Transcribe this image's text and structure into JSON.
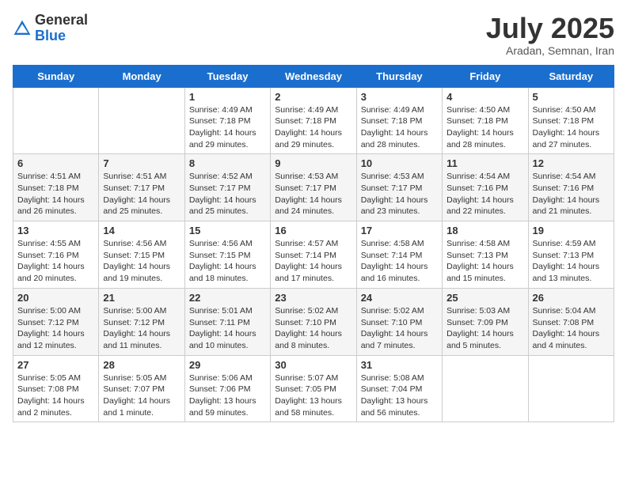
{
  "header": {
    "logo_general": "General",
    "logo_blue": "Blue",
    "month_title": "July 2025",
    "subtitle": "Aradan, Semnan, Iran"
  },
  "days_of_week": [
    "Sunday",
    "Monday",
    "Tuesday",
    "Wednesday",
    "Thursday",
    "Friday",
    "Saturday"
  ],
  "weeks": [
    [
      {
        "day": "",
        "detail": ""
      },
      {
        "day": "",
        "detail": ""
      },
      {
        "day": "1",
        "detail": "Sunrise: 4:49 AM\nSunset: 7:18 PM\nDaylight: 14 hours and 29 minutes."
      },
      {
        "day": "2",
        "detail": "Sunrise: 4:49 AM\nSunset: 7:18 PM\nDaylight: 14 hours and 29 minutes."
      },
      {
        "day": "3",
        "detail": "Sunrise: 4:49 AM\nSunset: 7:18 PM\nDaylight: 14 hours and 28 minutes."
      },
      {
        "day": "4",
        "detail": "Sunrise: 4:50 AM\nSunset: 7:18 PM\nDaylight: 14 hours and 28 minutes."
      },
      {
        "day": "5",
        "detail": "Sunrise: 4:50 AM\nSunset: 7:18 PM\nDaylight: 14 hours and 27 minutes."
      }
    ],
    [
      {
        "day": "6",
        "detail": "Sunrise: 4:51 AM\nSunset: 7:18 PM\nDaylight: 14 hours and 26 minutes."
      },
      {
        "day": "7",
        "detail": "Sunrise: 4:51 AM\nSunset: 7:17 PM\nDaylight: 14 hours and 25 minutes."
      },
      {
        "day": "8",
        "detail": "Sunrise: 4:52 AM\nSunset: 7:17 PM\nDaylight: 14 hours and 25 minutes."
      },
      {
        "day": "9",
        "detail": "Sunrise: 4:53 AM\nSunset: 7:17 PM\nDaylight: 14 hours and 24 minutes."
      },
      {
        "day": "10",
        "detail": "Sunrise: 4:53 AM\nSunset: 7:17 PM\nDaylight: 14 hours and 23 minutes."
      },
      {
        "day": "11",
        "detail": "Sunrise: 4:54 AM\nSunset: 7:16 PM\nDaylight: 14 hours and 22 minutes."
      },
      {
        "day": "12",
        "detail": "Sunrise: 4:54 AM\nSunset: 7:16 PM\nDaylight: 14 hours and 21 minutes."
      }
    ],
    [
      {
        "day": "13",
        "detail": "Sunrise: 4:55 AM\nSunset: 7:16 PM\nDaylight: 14 hours and 20 minutes."
      },
      {
        "day": "14",
        "detail": "Sunrise: 4:56 AM\nSunset: 7:15 PM\nDaylight: 14 hours and 19 minutes."
      },
      {
        "day": "15",
        "detail": "Sunrise: 4:56 AM\nSunset: 7:15 PM\nDaylight: 14 hours and 18 minutes."
      },
      {
        "day": "16",
        "detail": "Sunrise: 4:57 AM\nSunset: 7:14 PM\nDaylight: 14 hours and 17 minutes."
      },
      {
        "day": "17",
        "detail": "Sunrise: 4:58 AM\nSunset: 7:14 PM\nDaylight: 14 hours and 16 minutes."
      },
      {
        "day": "18",
        "detail": "Sunrise: 4:58 AM\nSunset: 7:13 PM\nDaylight: 14 hours and 15 minutes."
      },
      {
        "day": "19",
        "detail": "Sunrise: 4:59 AM\nSunset: 7:13 PM\nDaylight: 14 hours and 13 minutes."
      }
    ],
    [
      {
        "day": "20",
        "detail": "Sunrise: 5:00 AM\nSunset: 7:12 PM\nDaylight: 14 hours and 12 minutes."
      },
      {
        "day": "21",
        "detail": "Sunrise: 5:00 AM\nSunset: 7:12 PM\nDaylight: 14 hours and 11 minutes."
      },
      {
        "day": "22",
        "detail": "Sunrise: 5:01 AM\nSunset: 7:11 PM\nDaylight: 14 hours and 10 minutes."
      },
      {
        "day": "23",
        "detail": "Sunrise: 5:02 AM\nSunset: 7:10 PM\nDaylight: 14 hours and 8 minutes."
      },
      {
        "day": "24",
        "detail": "Sunrise: 5:02 AM\nSunset: 7:10 PM\nDaylight: 14 hours and 7 minutes."
      },
      {
        "day": "25",
        "detail": "Sunrise: 5:03 AM\nSunset: 7:09 PM\nDaylight: 14 hours and 5 minutes."
      },
      {
        "day": "26",
        "detail": "Sunrise: 5:04 AM\nSunset: 7:08 PM\nDaylight: 14 hours and 4 minutes."
      }
    ],
    [
      {
        "day": "27",
        "detail": "Sunrise: 5:05 AM\nSunset: 7:08 PM\nDaylight: 14 hours and 2 minutes."
      },
      {
        "day": "28",
        "detail": "Sunrise: 5:05 AM\nSunset: 7:07 PM\nDaylight: 14 hours and 1 minute."
      },
      {
        "day": "29",
        "detail": "Sunrise: 5:06 AM\nSunset: 7:06 PM\nDaylight: 13 hours and 59 minutes."
      },
      {
        "day": "30",
        "detail": "Sunrise: 5:07 AM\nSunset: 7:05 PM\nDaylight: 13 hours and 58 minutes."
      },
      {
        "day": "31",
        "detail": "Sunrise: 5:08 AM\nSunset: 7:04 PM\nDaylight: 13 hours and 56 minutes."
      },
      {
        "day": "",
        "detail": ""
      },
      {
        "day": "",
        "detail": ""
      }
    ]
  ]
}
